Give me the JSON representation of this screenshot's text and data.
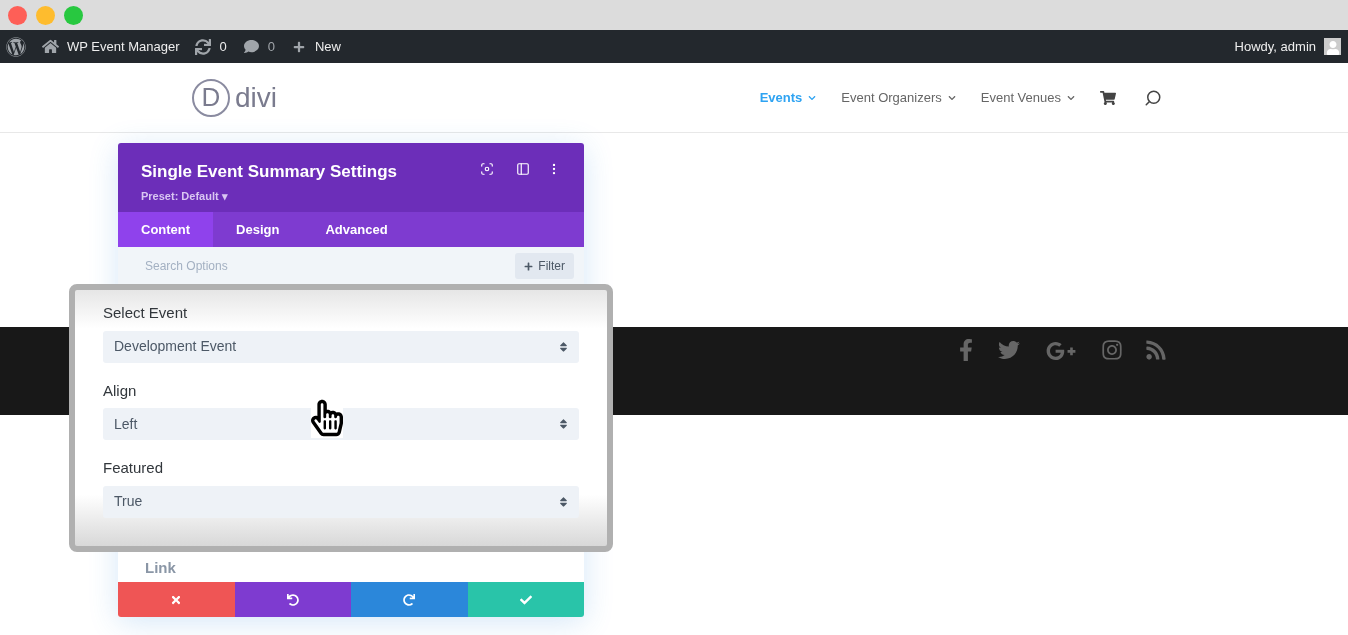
{
  "admin_bar": {
    "site": "WP Event Manager",
    "updates": "0",
    "comments": "0",
    "new": "New",
    "greeting": "Howdy, admin"
  },
  "header": {
    "logo_mark": "D",
    "logo": "divi",
    "nav": [
      {
        "label": "Events",
        "selected": true
      },
      {
        "label": "Event Organizers",
        "selected": false
      },
      {
        "label": "Event Venues",
        "selected": false
      }
    ]
  },
  "settings_panel": {
    "title": "Single Event Summary Settings",
    "preset": "Preset: Default ▾",
    "tabs": [
      {
        "label": "Content",
        "selected": true
      },
      {
        "label": "Design",
        "selected": false
      },
      {
        "label": "Advanced",
        "selected": false
      }
    ],
    "search": {
      "placeholder": "Search Options"
    },
    "filter": "Filter",
    "hidden_label": "Link",
    "actions": [
      {
        "kind": "cancel",
        "color": "#ef5555"
      },
      {
        "kind": "undo",
        "color": "#7e3bd0"
      },
      {
        "kind": "redo",
        "color": "#2b87da"
      },
      {
        "kind": "save",
        "color": "#29c4a9"
      }
    ]
  },
  "zoomed_fields": [
    {
      "label": "Select Event",
      "value": "Development Event"
    },
    {
      "label": "Align",
      "value": "Left"
    },
    {
      "label": "Featured",
      "value": "True"
    }
  ]
}
